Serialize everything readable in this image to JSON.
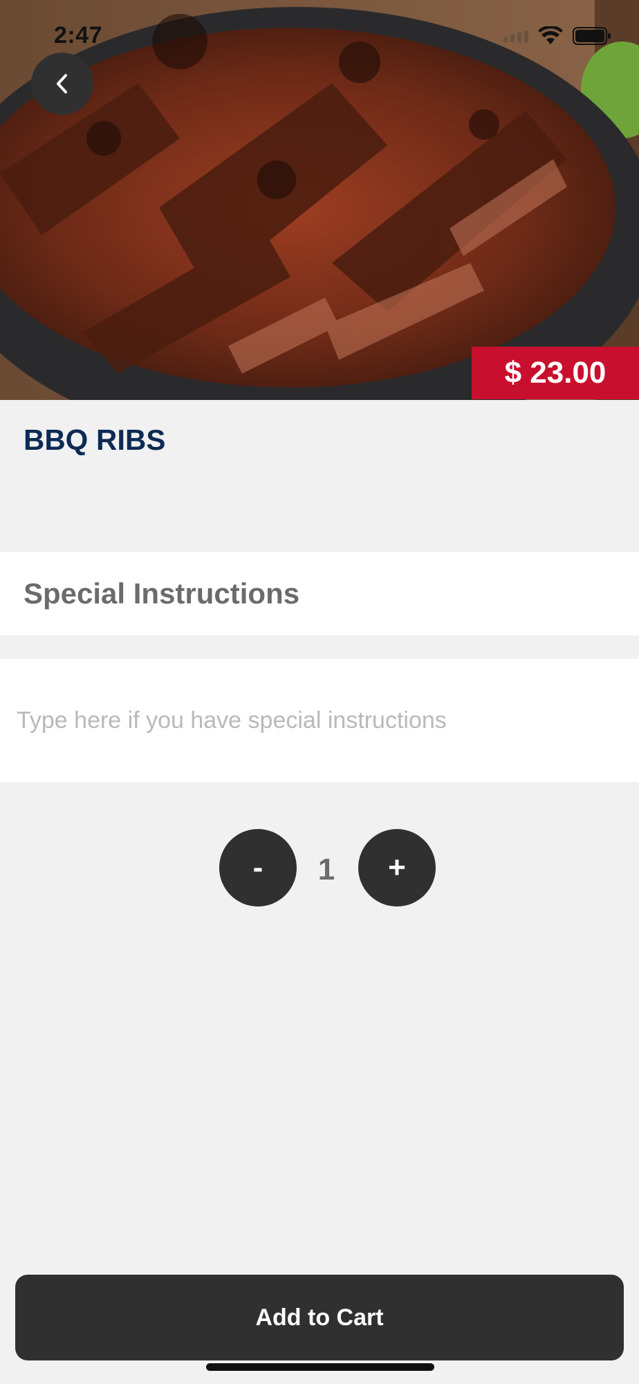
{
  "status_bar": {
    "time": "2:47"
  },
  "hero": {
    "image_icon": "bbq-ribs-photo"
  },
  "back_button": {
    "icon": "chevron-left-icon"
  },
  "product": {
    "title": "BBQ RIBS",
    "price": "$ 23.00",
    "price_badge_color": "#c8102e",
    "title_color": "#0d2a54"
  },
  "special_instructions": {
    "header": "Special Instructions",
    "placeholder": "Type here if you have special instructions",
    "value": ""
  },
  "quantity": {
    "minus_label": "-",
    "value": "1",
    "plus_label": "+"
  },
  "cart": {
    "button_label": "Add to Cart"
  },
  "colors": {
    "background": "#f1f1f2",
    "dark_button": "#303030"
  }
}
